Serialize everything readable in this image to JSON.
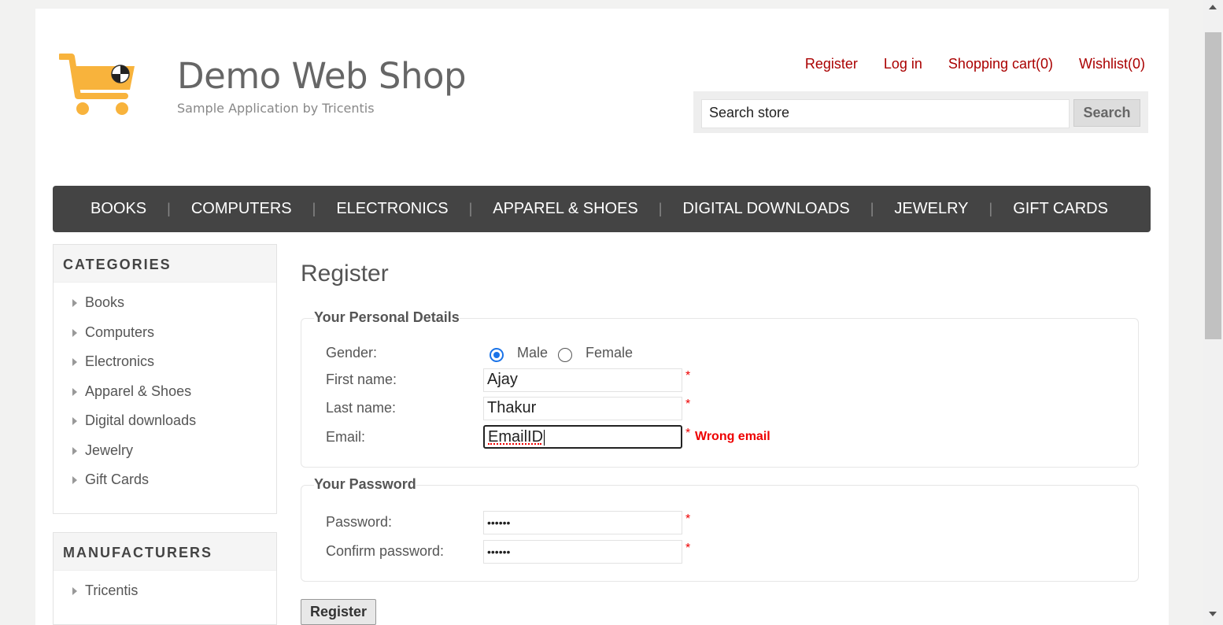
{
  "header": {
    "logo_title": "Demo Web Shop",
    "logo_subtitle": "Sample Application by Tricentis",
    "links": [
      "Register",
      "Log in",
      "Shopping cart(0)",
      "Wishlist(0)"
    ],
    "search_value": "Search store",
    "search_button": "Search"
  },
  "topmenu": [
    "BOOKS",
    "COMPUTERS",
    "ELECTRONICS",
    "APPAREL & SHOES",
    "DIGITAL DOWNLOADS",
    "JEWELRY",
    "GIFT CARDS"
  ],
  "categories": {
    "title": "CATEGORIES",
    "items": [
      "Books",
      "Computers",
      "Electronics",
      "Apparel & Shoes",
      "Digital downloads",
      "Jewelry",
      "Gift Cards"
    ]
  },
  "manufacturers": {
    "title": "MANUFACTURERS",
    "items": [
      "Tricentis"
    ]
  },
  "form": {
    "title": "Register",
    "personal_legend": "Your Personal Details",
    "gender_label": "Gender:",
    "male_label": "Male",
    "female_label": "Female",
    "first_name_label": "First name:",
    "first_name_value": "Ajay",
    "last_name_label": "Last name:",
    "last_name_value": "Thakur",
    "email_label": "Email:",
    "email_value": "EmailID",
    "email_error": "Wrong email",
    "required_mark": "*",
    "password_legend": "Your Password",
    "password_label": "Password:",
    "password_value": "••••••",
    "confirm_label": "Confirm password:",
    "confirm_value": "••••••",
    "submit_label": "Register"
  },
  "colors": {
    "link": "#aa0000",
    "menu_bg": "#444444",
    "error": "#ee0000",
    "logo_cart": "#f8b33c"
  }
}
